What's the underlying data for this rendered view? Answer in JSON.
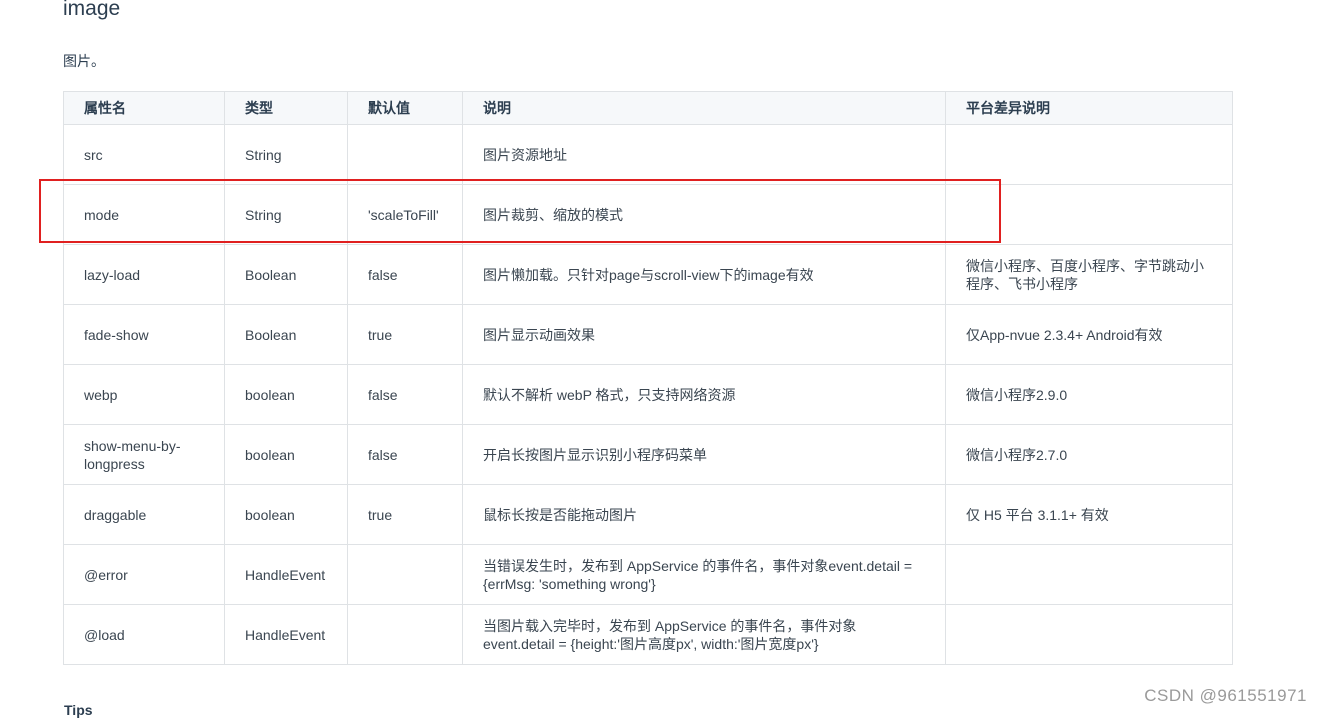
{
  "page": {
    "title": "image",
    "intro": "图片。",
    "tips_heading": "Tips",
    "watermark": "CSDN @961551971"
  },
  "table": {
    "headers": [
      "属性名",
      "类型",
      "默认值",
      "说明",
      "平台差异说明"
    ],
    "rows": [
      [
        "src",
        "String",
        "",
        "图片资源地址",
        ""
      ],
      [
        "mode",
        "String",
        "'scaleToFill'",
        "图片裁剪、缩放的模式",
        ""
      ],
      [
        "lazy-load",
        "Boolean",
        "false",
        "图片懒加载。只针对page与scroll-view下的image有效",
        "微信小程序、百度小程序、字节跳动小程序、飞书小程序"
      ],
      [
        "fade-show",
        "Boolean",
        "true",
        "图片显示动画效果",
        "仅App-nvue 2.3.4+ Android有效"
      ],
      [
        "webp",
        "boolean",
        "false",
        "默认不解析 webP 格式，只支持网络资源",
        "微信小程序2.9.0"
      ],
      [
        "show-menu-by-longpress",
        "boolean",
        "false",
        "开启长按图片显示识别小程序码菜单",
        "微信小程序2.7.0"
      ],
      [
        "draggable",
        "boolean",
        "true",
        "鼠标长按是否能拖动图片",
        "仅 H5 平台 3.1.1+ 有效"
      ],
      [
        "@error",
        "HandleEvent",
        "",
        "当错误发生时，发布到 AppService 的事件名，事件对象event.detail = {errMsg: 'something wrong'}",
        ""
      ],
      [
        "@load",
        "HandleEvent",
        "",
        "当图片载入完毕时，发布到 AppService 的事件名，事件对象event.detail = {height:'图片高度px', width:'图片宽度px'}",
        ""
      ]
    ]
  },
  "colors": {
    "highlight_border": "#e02020",
    "table_border": "#dfe2e5",
    "header_bg": "#f6f8fa"
  }
}
